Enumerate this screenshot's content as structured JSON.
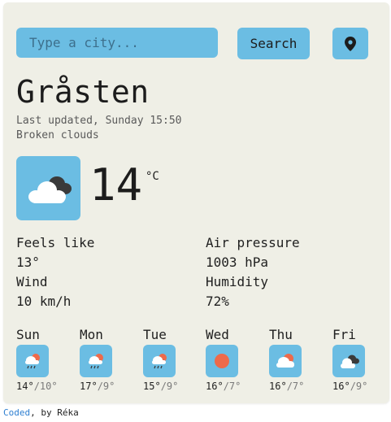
{
  "search": {
    "placeholder": "Type a city...",
    "button_label": "Search"
  },
  "current": {
    "city": "Gråsten",
    "updated": "Last updated, Sunday 15:50",
    "description": "Broken clouds",
    "temperature": "14",
    "unit": "°C",
    "icon": "broken-clouds-icon"
  },
  "details": {
    "feels_like_label": "Feels like",
    "feels_like_value": "13°",
    "wind_label": "Wind",
    "wind_value": "10 km/h",
    "pressure_label": "Air pressure",
    "pressure_value": "1003 hPa",
    "humidity_label": "Humidity",
    "humidity_value": "72%"
  },
  "forecast": [
    {
      "day": "Sun",
      "max": "14°",
      "min": "/10°",
      "icon": "rain-sun-icon"
    },
    {
      "day": "Mon",
      "max": "17°",
      "min": "/9°",
      "icon": "rain-sun-icon"
    },
    {
      "day": "Tue",
      "max": "15°",
      "min": "/9°",
      "icon": "rain-sun-icon"
    },
    {
      "day": "Wed",
      "max": "16°",
      "min": "/7°",
      "icon": "sun-icon"
    },
    {
      "day": "Thu",
      "max": "16°",
      "min": "/7°",
      "icon": "partly-cloudy-icon"
    },
    {
      "day": "Fri",
      "max": "16°",
      "min": "/9°",
      "icon": "broken-clouds-icon"
    }
  ],
  "footer": {
    "link_text": "Coded",
    "rest": ", by Réka"
  },
  "colors": {
    "accent": "#6bbde3",
    "background": "#efefe6",
    "sun": "#ee6a4a",
    "cloud_dark": "#3a3a3a"
  }
}
